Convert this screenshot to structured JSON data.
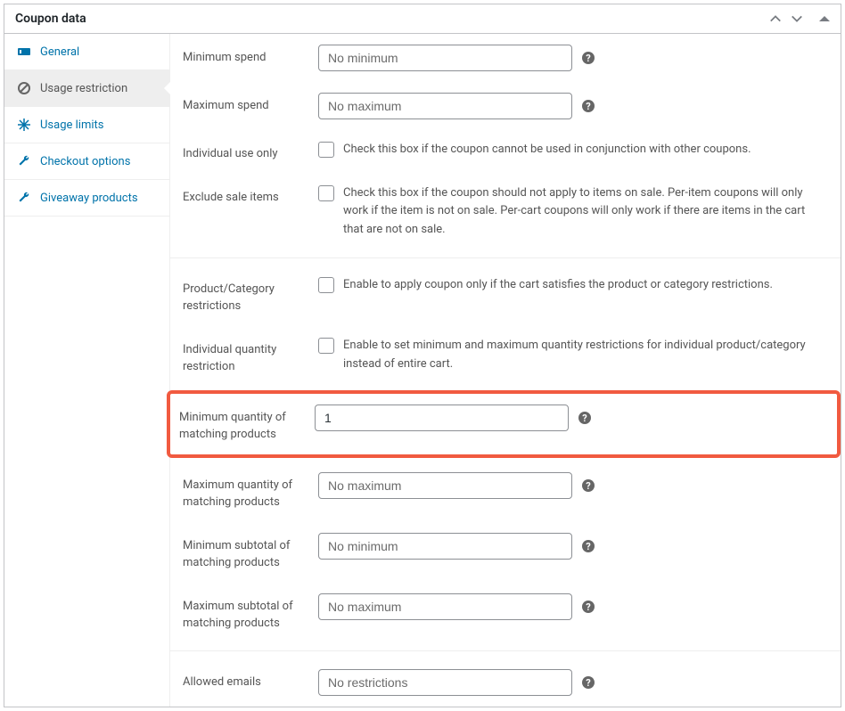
{
  "header": {
    "title": "Coupon data"
  },
  "sidebar": {
    "items": [
      {
        "label": "General",
        "icon": "ticket"
      },
      {
        "label": "Usage restriction",
        "icon": "ban",
        "active": true
      },
      {
        "label": "Usage limits",
        "icon": "adjust"
      },
      {
        "label": "Checkout options",
        "icon": "wrench"
      },
      {
        "label": "Giveaway products",
        "icon": "wrench"
      }
    ]
  },
  "form": {
    "min_spend": {
      "label": "Minimum spend",
      "placeholder": "No minimum",
      "value": ""
    },
    "max_spend": {
      "label": "Maximum spend",
      "placeholder": "No maximum",
      "value": ""
    },
    "individual_use": {
      "label": "Individual use only",
      "desc": "Check this box if the coupon cannot be used in conjunction with other coupons."
    },
    "exclude_sale": {
      "label": "Exclude sale items",
      "desc": "Check this box if the coupon should not apply to items on sale. Per-item coupons will only work if the item is not on sale. Per-cart coupons will only work if there are items in the cart that are not on sale."
    },
    "product_cat_restrictions": {
      "label": "Product/Category restrictions",
      "desc": "Enable to apply coupon only if the cart satisfies the product or category restrictions."
    },
    "individual_qty_restriction": {
      "label": "Individual quantity restriction",
      "desc": "Enable to set minimum and maximum quantity restrictions for individual product/category instead of entire cart."
    },
    "min_qty": {
      "label": "Minimum quantity of matching products",
      "placeholder": "",
      "value": "1"
    },
    "max_qty": {
      "label": "Maximum quantity of matching products",
      "placeholder": "No maximum",
      "value": ""
    },
    "min_subtotal": {
      "label": "Minimum subtotal of matching products",
      "placeholder": "No minimum",
      "value": ""
    },
    "max_subtotal": {
      "label": "Maximum subtotal of matching products",
      "placeholder": "No maximum",
      "value": ""
    },
    "allowed_emails": {
      "label": "Allowed emails",
      "placeholder": "No restrictions",
      "value": ""
    }
  }
}
